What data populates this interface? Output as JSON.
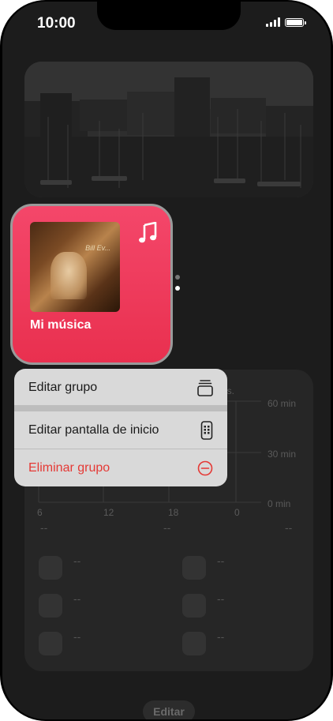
{
  "status_bar": {
    "time": "10:00"
  },
  "music_widget": {
    "label": "Mi música",
    "album_title": "Bill Ev..."
  },
  "context_menu": {
    "items": [
      {
        "label": "Editar grupo",
        "icon": "stack-icon"
      },
      {
        "label": "Editar pantalla de inicio",
        "icon": "phone-apps-icon"
      },
      {
        "label": "Eliminar grupo",
        "icon": "minus-circle-icon",
        "destructive": true
      }
    ]
  },
  "background_widget": {
    "y_labels": [
      "60 min",
      "30 min",
      "0 min"
    ],
    "x_labels": [
      "6",
      "12",
      "18",
      "0"
    ],
    "caption_fragment": "es.",
    "dash": "--"
  },
  "bottom_button": {
    "label": "Editar"
  },
  "colors": {
    "accent": "#e9304f",
    "destructive": "#e53935",
    "menu_bg": "#d9d9d9"
  }
}
